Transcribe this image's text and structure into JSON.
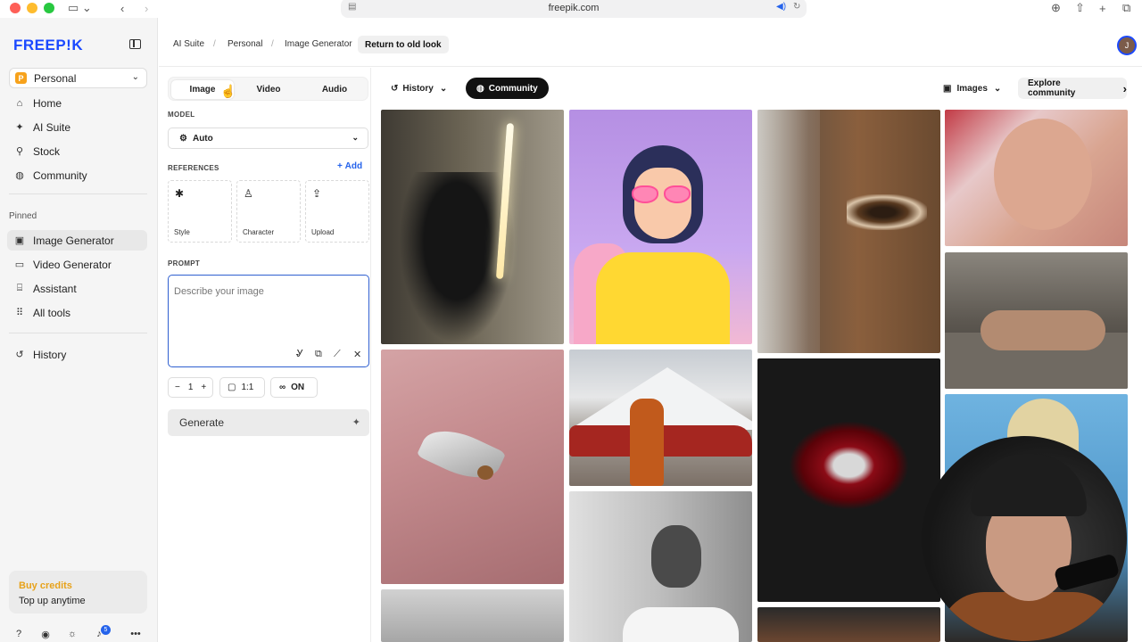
{
  "browser": {
    "url": "freepik.com"
  },
  "sidebar": {
    "logo": "FREEP!K",
    "workspace": {
      "badge": "P",
      "name": "Personal"
    },
    "nav": [
      {
        "label": "Home",
        "icon": "home-icon"
      },
      {
        "label": "AI Suite",
        "icon": "sparkle-icon"
      },
      {
        "label": "Stock",
        "icon": "search-icon"
      },
      {
        "label": "Community",
        "icon": "globe-icon"
      }
    ],
    "pinned_label": "Pinned",
    "pinned": [
      {
        "label": "Image Generator",
        "icon": "image-icon",
        "active": true
      },
      {
        "label": "Video Generator",
        "icon": "video-icon"
      },
      {
        "label": "Assistant",
        "icon": "chat-icon"
      },
      {
        "label": "All tools",
        "icon": "grid-icon"
      }
    ],
    "history_label": "History",
    "credits": {
      "title": "Buy credits",
      "subtitle": "Top up anytime"
    },
    "notification_count": "5"
  },
  "header": {
    "breadcrumbs": [
      "AI Suite",
      "Personal",
      "Image Generator"
    ],
    "old_look_label": "Return to old look",
    "avatar_initial": "J"
  },
  "panel": {
    "tabs": [
      "Image",
      "Video",
      "Audio"
    ],
    "model_label": "MODEL",
    "model_value": "Auto",
    "references_label": "REFERENCES",
    "add_label": "Add",
    "reference_cards": [
      "Style",
      "Character",
      "Upload"
    ],
    "prompt_label": "PROMPT",
    "prompt_placeholder": "Describe your image",
    "quantity": "1",
    "aspect_ratio": "1:1",
    "toggle_label": "ON",
    "generate_label": "Generate"
  },
  "gallery": {
    "history_label": "History",
    "community_label": "Community",
    "filter_label": "Images",
    "explore_label": "Explore community"
  },
  "colors": {
    "brand": "#1b49ff",
    "credits": "#e7a21a",
    "link": "#2563eb"
  }
}
